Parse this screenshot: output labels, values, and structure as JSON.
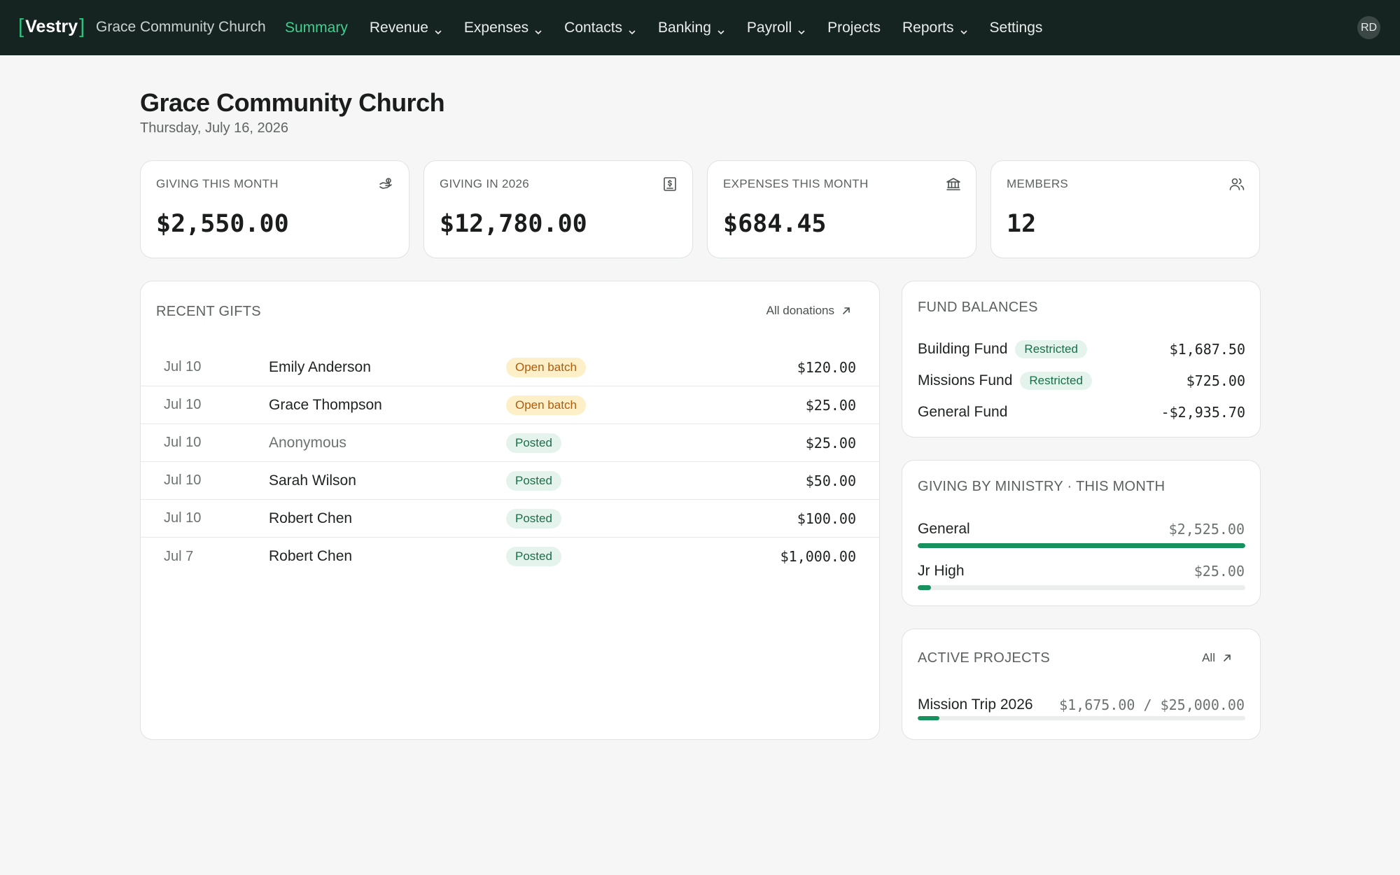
{
  "nav": {
    "logo_text": "Vestry",
    "org_name": "Grace Community Church",
    "items": [
      {
        "label": "Summary",
        "active": true,
        "dropdown": false
      },
      {
        "label": "Revenue",
        "active": false,
        "dropdown": true
      },
      {
        "label": "Expenses",
        "active": false,
        "dropdown": true
      },
      {
        "label": "Contacts",
        "active": false,
        "dropdown": true
      },
      {
        "label": "Banking",
        "active": false,
        "dropdown": true
      },
      {
        "label": "Payroll",
        "active": false,
        "dropdown": true
      },
      {
        "label": "Projects",
        "active": false,
        "dropdown": false
      },
      {
        "label": "Reports",
        "active": false,
        "dropdown": true
      },
      {
        "label": "Settings",
        "active": false,
        "dropdown": false
      }
    ],
    "avatar_initials": "RD"
  },
  "header": {
    "title": "Grace Community Church",
    "date": "Thursday, July 16, 2026"
  },
  "stats": [
    {
      "label": "GIVING THIS MONTH",
      "value": "$2,550.00",
      "icon": "hand-coins-icon"
    },
    {
      "label": "GIVING IN 2026",
      "value": "$12,780.00",
      "icon": "receipt-dollar-icon"
    },
    {
      "label": "EXPENSES THIS MONTH",
      "value": "$684.45",
      "icon": "bank-icon"
    },
    {
      "label": "MEMBERS",
      "value": "12",
      "icon": "users-icon"
    }
  ],
  "recent_gifts": {
    "title": "RECENT GIFTS",
    "link_label": "All donations",
    "rows": [
      {
        "date": "Jul 10",
        "name": "Emily Anderson",
        "status": "Open batch",
        "amount": "$120.00"
      },
      {
        "date": "Jul 10",
        "name": "Grace Thompson",
        "status": "Open batch",
        "amount": "$25.00"
      },
      {
        "date": "Jul 10",
        "name": "Anonymous",
        "status": "Posted",
        "amount": "$25.00"
      },
      {
        "date": "Jul 10",
        "name": "Sarah Wilson",
        "status": "Posted",
        "amount": "$50.00"
      },
      {
        "date": "Jul 10",
        "name": "Robert Chen",
        "status": "Posted",
        "amount": "$100.00"
      },
      {
        "date": "Jul 7",
        "name": "Robert Chen",
        "status": "Posted",
        "amount": "$1,000.00"
      }
    ]
  },
  "fund_balances": {
    "title": "FUND BALANCES",
    "rows": [
      {
        "name": "Building Fund",
        "badge": "Restricted",
        "amount": "$1,687.50"
      },
      {
        "name": "Missions Fund",
        "badge": "Restricted",
        "amount": "$725.00"
      },
      {
        "name": "General Fund",
        "badge": "",
        "amount": "-$2,935.70"
      }
    ]
  },
  "giving_by_ministry": {
    "title": "GIVING BY MINISTRY · THIS MONTH",
    "rows": [
      {
        "name": "General",
        "amount": "$2,525.00",
        "fraction": 1.0
      },
      {
        "name": "Jr High",
        "amount": "$25.00",
        "fraction": 0.0099
      }
    ]
  },
  "active_projects": {
    "title": "ACTIVE PROJECTS",
    "link_label": "All",
    "rows": [
      {
        "name": "Mission Trip 2026",
        "progress_text": "$1,675.00 / $25,000.00",
        "fraction": 0.067
      }
    ]
  },
  "colors": {
    "nav_bg": "#162421",
    "accent": "#3fcf8e",
    "bar_fill": "#17925e",
    "badge_open_bg": "#fdf0c9",
    "badge_posted_bg": "#e4f4ec"
  }
}
